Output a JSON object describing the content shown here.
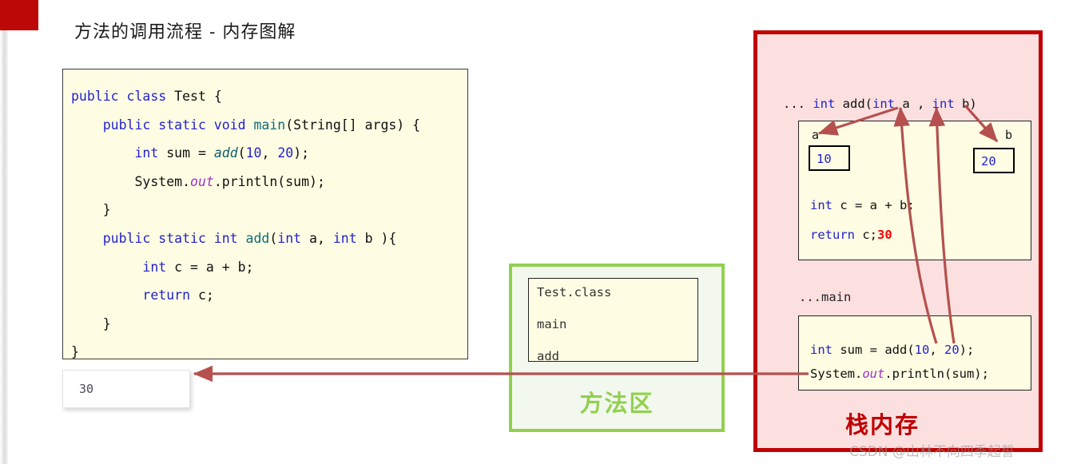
{
  "slide": {
    "title": "方法的调用流程 - 内存图解",
    "accent_color": "#BD0808"
  },
  "code_panel": {
    "background": "#FEFDE3",
    "lines": [
      [
        {
          "t": "public class ",
          "c": "kw"
        },
        {
          "t": "Test",
          "c": "pln"
        },
        {
          "t": " {",
          "c": "pln"
        }
      ],
      [
        {
          "t": "    public static void ",
          "c": "kw"
        },
        {
          "t": "main",
          "c": "type"
        },
        {
          "t": "(String[] args) {",
          "c": "pln"
        }
      ],
      [
        {
          "t": "        int",
          "c": "kw"
        },
        {
          "t": " sum = ",
          "c": "pln"
        },
        {
          "t": "add",
          "c": "meth"
        },
        {
          "t": "(",
          "c": "pln"
        },
        {
          "t": "10",
          "c": "num"
        },
        {
          "t": ", ",
          "c": "pln"
        },
        {
          "t": "20",
          "c": "num"
        },
        {
          "t": ");",
          "c": "pln"
        }
      ],
      [
        {
          "t": "        System.",
          "c": "pln"
        },
        {
          "t": "out",
          "c": "fld"
        },
        {
          "t": ".println(sum);",
          "c": "pln"
        }
      ],
      [
        {
          "t": "    }",
          "c": "pln"
        }
      ],
      [
        {
          "t": "    public static int ",
          "c": "kw"
        },
        {
          "t": "add",
          "c": "type"
        },
        {
          "t": "(",
          "c": "pln"
        },
        {
          "t": "int",
          "c": "kw"
        },
        {
          "t": " a, ",
          "c": "pln"
        },
        {
          "t": "int",
          "c": "kw"
        },
        {
          "t": " b ){",
          "c": "pln"
        }
      ],
      [
        {
          "t": "         int",
          "c": "kw"
        },
        {
          "t": " c = a + b;",
          "c": "pln"
        }
      ],
      [
        {
          "t": "         return",
          "c": "kw"
        },
        {
          "t": " c;",
          "c": "pln"
        }
      ],
      [
        {
          "t": "    }",
          "c": "pln"
        }
      ],
      [
        {
          "t": "}",
          "c": "pln"
        }
      ]
    ]
  },
  "console": {
    "value": "30"
  },
  "method_area": {
    "label": "方法区",
    "border_color": "#92D050",
    "items": [
      "Test.class",
      "main",
      "add"
    ]
  },
  "stack_memory": {
    "label": "栈内存",
    "border_color": "#C00000",
    "background": "#FCE0E0",
    "signature": [
      {
        "t": "... ",
        "c": "pln"
      },
      {
        "t": "int",
        "c": "kw"
      },
      {
        "t": " add(",
        "c": "pln"
      },
      {
        "t": "int",
        "c": "kw"
      },
      {
        "t": " a , ",
        "c": "pln"
      },
      {
        "t": "int",
        "c": "kw"
      },
      {
        "t": " b)",
        "c": "pln"
      }
    ],
    "add_frame": {
      "var_a_label": "a",
      "var_a_value": "10",
      "var_b_label": "b",
      "var_b_value": "20",
      "line_1": [
        {
          "t": "int",
          "c": "kw"
        },
        {
          "t": " c = a + b;",
          "c": "pln"
        }
      ],
      "line_2": [
        {
          "t": "return",
          "c": "kw"
        },
        {
          "t": " c;",
          "c": "pln"
        },
        {
          "t": "30",
          "c": "ret-val"
        }
      ]
    },
    "main_label": "...main",
    "main_frame": {
      "line_1": [
        {
          "t": "int",
          "c": "kw"
        },
        {
          "t": " sum = add(",
          "c": "pln"
        },
        {
          "t": "10",
          "c": "num"
        },
        {
          "t": ", ",
          "c": "pln"
        },
        {
          "t": "20",
          "c": "num"
        },
        {
          "t": ");",
          "c": "pln"
        }
      ],
      "line_2": [
        {
          "t": "System.",
          "c": "pln"
        },
        {
          "t": "out",
          "c": "fld"
        },
        {
          "t": ".println(sum);",
          "c": "pln"
        }
      ]
    }
  },
  "arrows": {
    "color": "#B5504F",
    "items": [
      "arg-10-to-param-a",
      "arg-20-to-param-b",
      "param-a-to-var-a-box",
      "param-b-to-var-b-box",
      "return-to-console"
    ]
  },
  "watermark": {
    "text": "CSDN @山林不向四季起誓"
  }
}
